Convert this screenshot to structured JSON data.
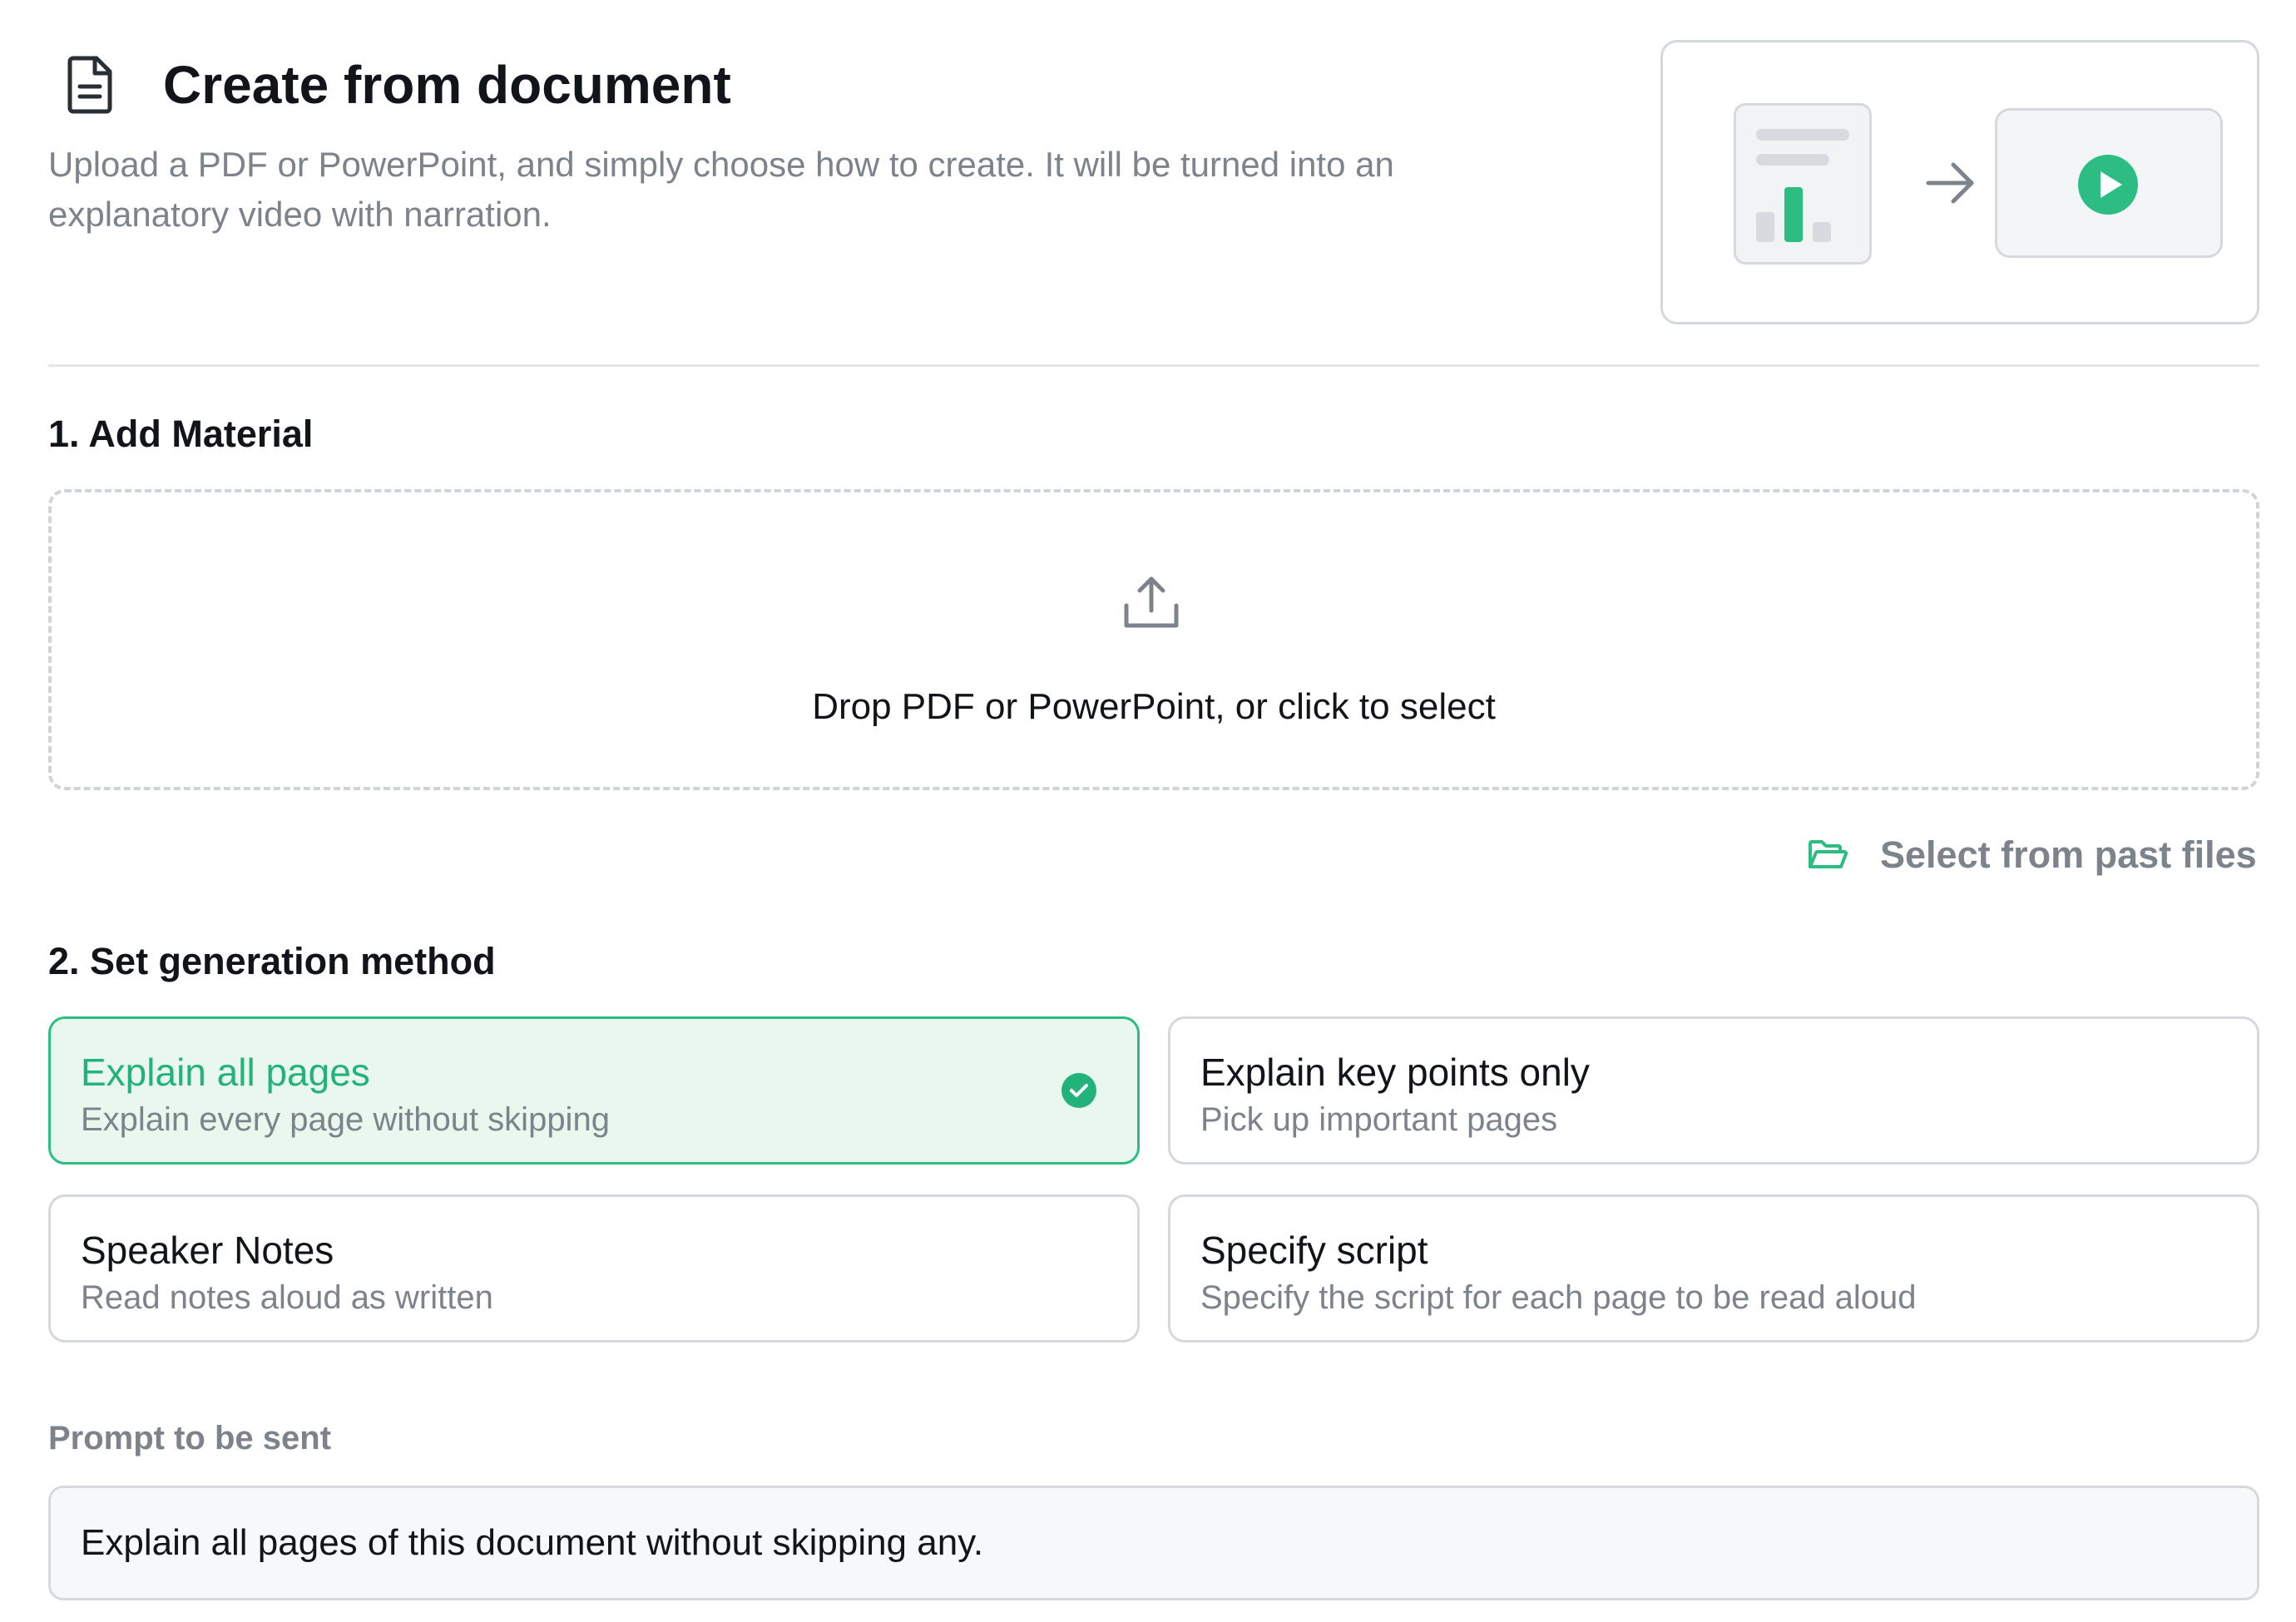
{
  "header": {
    "title": "Create from document",
    "description": "Upload a PDF or PowerPoint, and simply choose how to create. It will be turned into an explanatory video with narration."
  },
  "icons": {
    "title_icon": "document-icon",
    "hero_doc": "document-chart-icon",
    "hero_arrow": "arrow-right-icon",
    "hero_video": "play-icon",
    "upload": "upload-icon",
    "past_files": "folder-open-icon",
    "selected": "check-circle-icon"
  },
  "section1": {
    "title": "1. Add Material",
    "dropzone_label": "Drop PDF or PowerPoint, or click to select",
    "past_files_label": "Select from past files"
  },
  "section2": {
    "title": "2. Set generation method",
    "options": [
      {
        "title": "Explain all pages",
        "subtitle": "Explain every page without skipping",
        "selected": true
      },
      {
        "title": "Explain key points only",
        "subtitle": "Pick up important pages",
        "selected": false
      },
      {
        "title": "Speaker Notes",
        "subtitle": "Read notes aloud as written",
        "selected": false
      },
      {
        "title": "Specify script",
        "subtitle": "Specify the script for each page to be read aloud",
        "selected": false
      }
    ]
  },
  "prompt": {
    "label": "Prompt to be sent",
    "value": "Explain all pages of this document without skipping any."
  },
  "colors": {
    "accent": "#2bbd82",
    "accent_bg": "#eaf7ef",
    "muted_text": "#7c838b",
    "border": "#d5d9dd"
  }
}
